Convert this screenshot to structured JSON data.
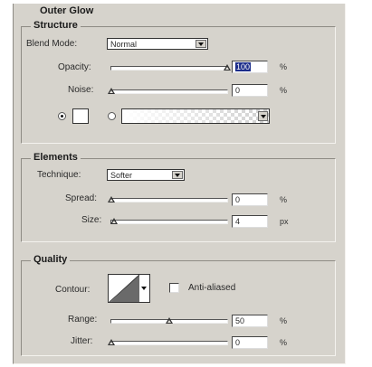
{
  "panel": {
    "title": "Outer Glow"
  },
  "structure": {
    "title": "Structure",
    "blend_mode_label": "Blend Mode:",
    "blend_mode_value": "Normal",
    "opacity_label": "Opacity:",
    "opacity_value": "100",
    "opacity_unit": "%",
    "opacity_level": 1.0,
    "noise_label": "Noise:",
    "noise_value": "0",
    "noise_unit": "%",
    "noise_level": 0.0,
    "color_mode_selected": "solid-color",
    "color_swatch": "#ffffff"
  },
  "elements": {
    "title": "Elements",
    "technique_label": "Technique:",
    "technique_value": "Softer",
    "spread_label": "Spread:",
    "spread_value": "0",
    "spread_unit": "%",
    "spread_level": 0.0,
    "size_label": "Size:",
    "size_value": "4",
    "size_unit": "px",
    "size_level": 0.02
  },
  "quality": {
    "title": "Quality",
    "contour_label": "Contour:",
    "anti_aliased_label": "Anti-aliased",
    "anti_aliased_checked": false,
    "range_label": "Range:",
    "range_value": "50",
    "range_unit": "%",
    "range_level": 0.5,
    "jitter_label": "Jitter:",
    "jitter_value": "0",
    "jitter_unit": "%",
    "jitter_level": 0.0
  }
}
